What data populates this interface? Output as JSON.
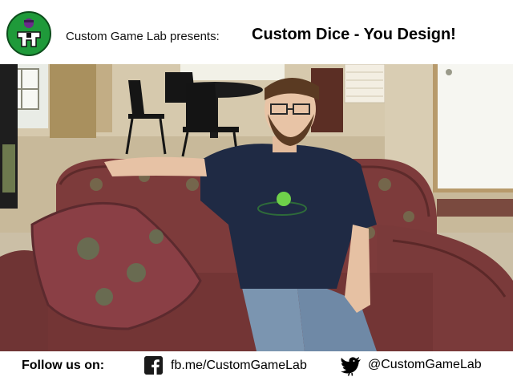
{
  "header": {
    "logo_icon": "custom-game-lab-meeple-logo",
    "presents_text": "Custom Game Lab presents:",
    "title": "Custom Dice - You Design!"
  },
  "scene": {
    "description_icon": "video-frame-man-on-couch"
  },
  "footer": {
    "follow_label": "Follow us on:",
    "facebook_icon": "facebook-icon",
    "facebook_link": "fb.me/CustomGameLab",
    "twitter_icon": "bird-icon",
    "twitter_handle": "@CustomGameLab"
  },
  "colors": {
    "logo_green": "#1f9a3a",
    "couch_red": "#8a3c3c",
    "shirt_navy": "#1f2a44"
  }
}
